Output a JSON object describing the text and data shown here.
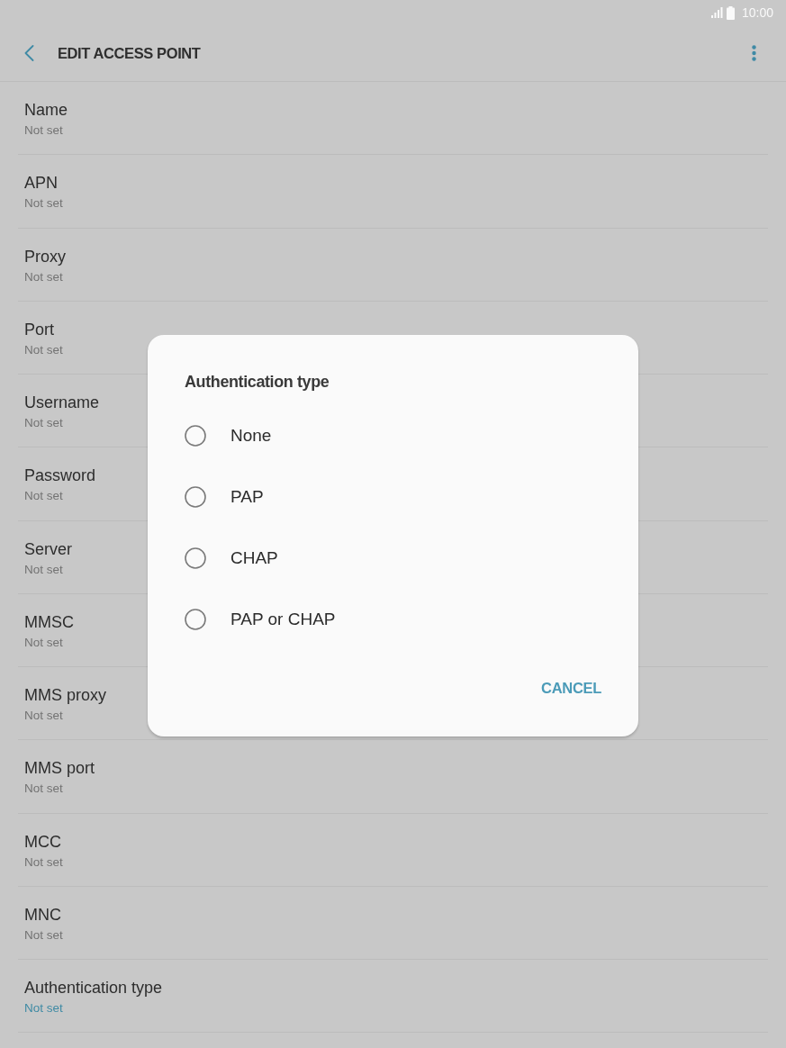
{
  "status_bar": {
    "time": "10:00"
  },
  "header": {
    "title": "EDIT ACCESS POINT"
  },
  "settings": [
    {
      "label": "Name",
      "value": "Not set",
      "highlighted": false
    },
    {
      "label": "APN",
      "value": "Not set",
      "highlighted": false
    },
    {
      "label": "Proxy",
      "value": "Not set",
      "highlighted": false
    },
    {
      "label": "Port",
      "value": "Not set",
      "highlighted": false
    },
    {
      "label": "Username",
      "value": "Not set",
      "highlighted": false
    },
    {
      "label": "Password",
      "value": "Not set",
      "highlighted": false
    },
    {
      "label": "Server",
      "value": "Not set",
      "highlighted": false
    },
    {
      "label": "MMSC",
      "value": "Not set",
      "highlighted": false
    },
    {
      "label": "MMS proxy",
      "value": "Not set",
      "highlighted": false
    },
    {
      "label": "MMS port",
      "value": "Not set",
      "highlighted": false
    },
    {
      "label": "MCC",
      "value": "Not set",
      "highlighted": false
    },
    {
      "label": "MNC",
      "value": "Not set",
      "highlighted": false
    },
    {
      "label": "Authentication type",
      "value": "Not set",
      "highlighted": true
    }
  ],
  "dialog": {
    "title": "Authentication type",
    "options": [
      {
        "label": "None",
        "selected": false
      },
      {
        "label": "PAP",
        "selected": false
      },
      {
        "label": "CHAP",
        "selected": false
      },
      {
        "label": "PAP or CHAP",
        "selected": false
      }
    ],
    "buttons": [
      "CANCEL"
    ]
  }
}
